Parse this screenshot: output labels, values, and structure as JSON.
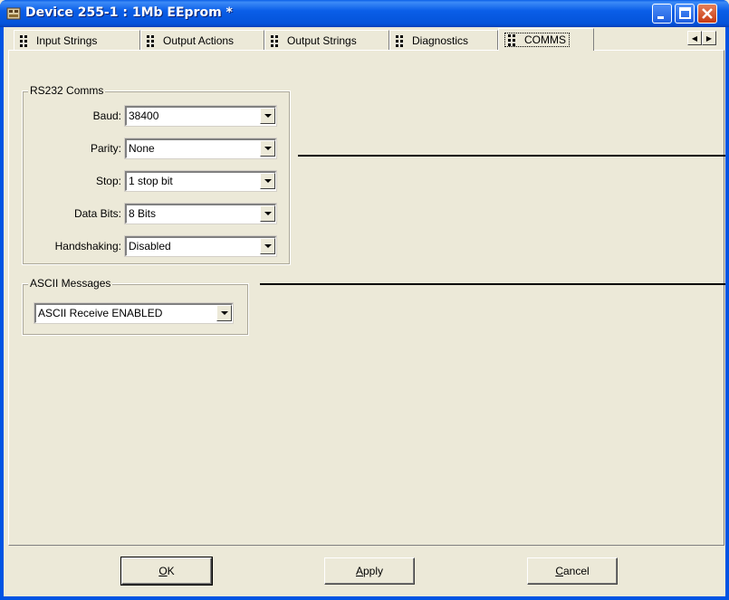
{
  "window": {
    "title": "Device 255-1 : 1Mb EEprom *"
  },
  "tabs": [
    {
      "label": "Input Strings",
      "active": false
    },
    {
      "label": "Output Actions",
      "active": false
    },
    {
      "label": "Output Strings",
      "active": false
    },
    {
      "label": "Diagnostics",
      "active": false
    },
    {
      "label": "COMMS",
      "active": true
    }
  ],
  "rs232": {
    "title": "RS232 Comms",
    "baud": {
      "label": "Baud:",
      "value": "38400"
    },
    "parity": {
      "label": "Parity:",
      "value": "None"
    },
    "stop": {
      "label": "Stop:",
      "value": "1 stop bit"
    },
    "data_bits": {
      "label": "Data Bits:",
      "value": "8 Bits"
    },
    "handshaking": {
      "label": "Handshaking:",
      "value": "Disabled"
    }
  },
  "ascii": {
    "title": "ASCII Messages",
    "value": "ASCII Receive ENABLED"
  },
  "buttons": {
    "ok": {
      "mnemonic": "O",
      "rest": "K"
    },
    "apply": {
      "mnemonic": "A",
      "rest": "pply"
    },
    "cancel": {
      "mnemonic": "C",
      "rest": "ancel"
    }
  },
  "icons": [
    "app-icon",
    "minimize-icon",
    "maximize-icon",
    "close-icon",
    "grip-icon",
    "left-arrow-icon",
    "right-arrow-icon",
    "dropdown-arrow-icon"
  ],
  "colors": {
    "titlebar": "#0054e3",
    "face": "#ece9d8",
    "close_button": "#c83a12"
  }
}
